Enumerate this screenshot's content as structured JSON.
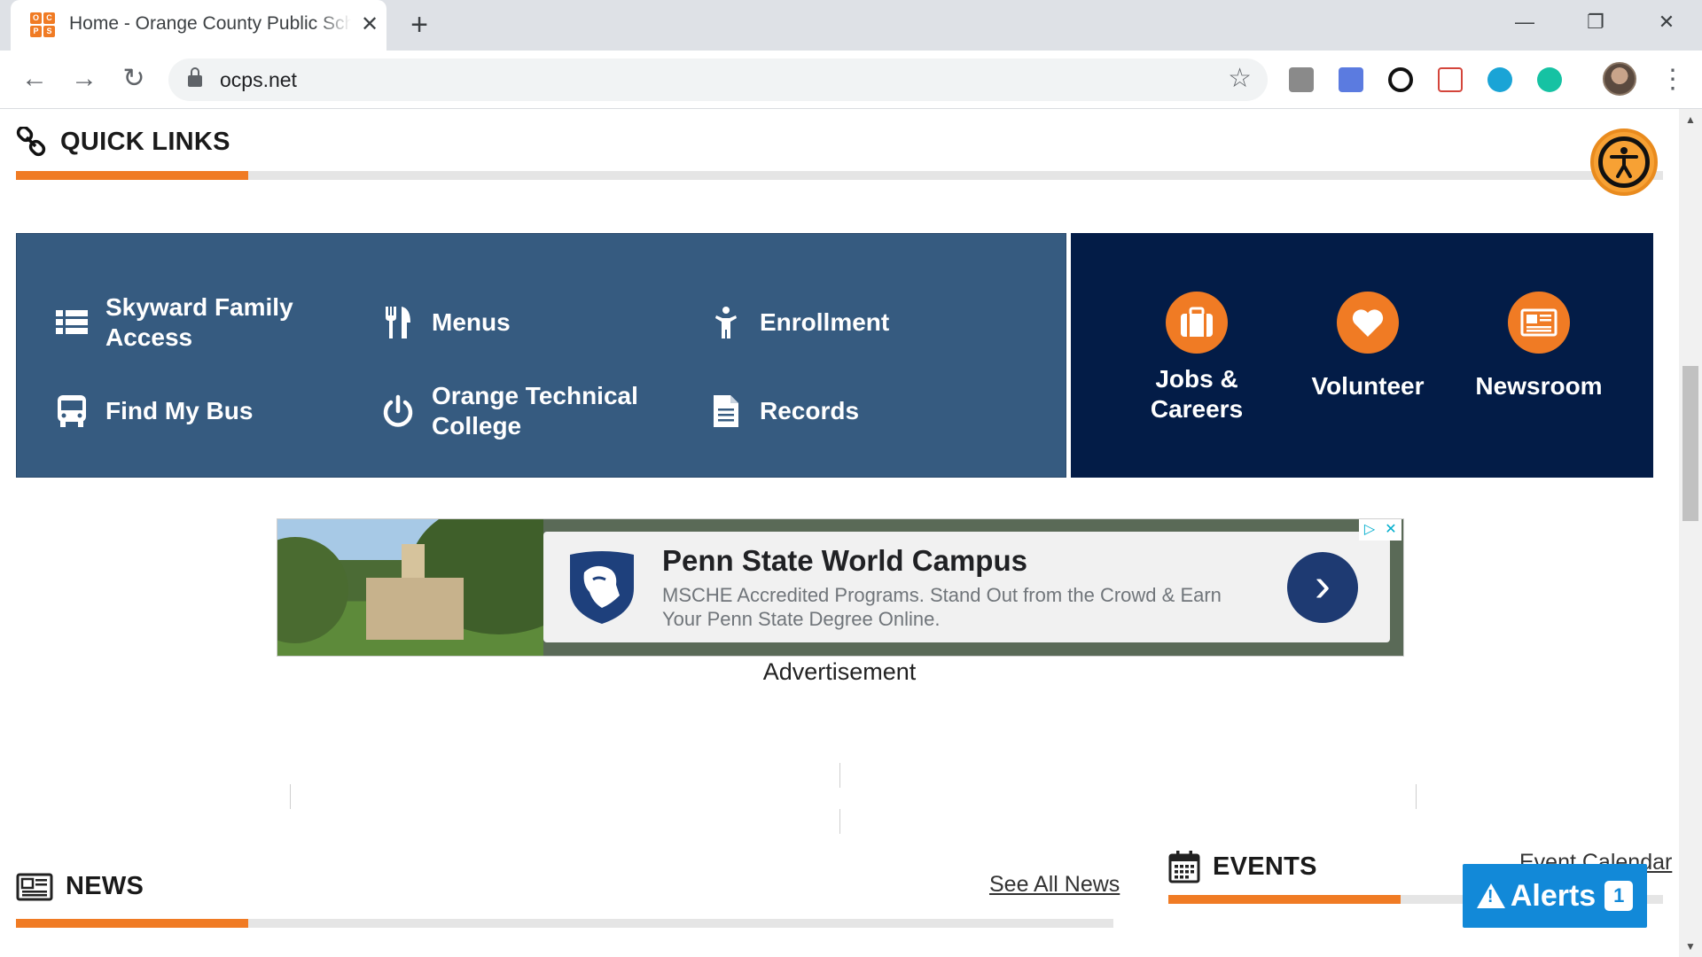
{
  "browser": {
    "tab_title": "Home - Orange County Public Schools",
    "url": "ocps.net",
    "favicon_letters": [
      "O",
      "C",
      "P",
      "S"
    ]
  },
  "quick_links": {
    "title": "QUICK LINKS",
    "left_items": [
      {
        "label_line1": "Skyward Family",
        "label_line2": "Access",
        "icon": "list-icon"
      },
      {
        "label_line1": "Menus",
        "label_line2": "",
        "icon": "fork-knife-icon"
      },
      {
        "label_line1": "Enrollment",
        "label_line2": "",
        "icon": "person-icon"
      },
      {
        "label_line1": "Find My Bus",
        "label_line2": "",
        "icon": "bus-icon"
      },
      {
        "label_line1": "Orange Technical",
        "label_line2": "College",
        "icon": "power-icon"
      },
      {
        "label_line1": "Records",
        "label_line2": "",
        "icon": "document-icon"
      }
    ],
    "right_items": [
      {
        "label_line1": "Jobs &",
        "label_line2": "Careers",
        "icon": "briefcase-icon"
      },
      {
        "label_line1": "Volunteer",
        "label_line2": "",
        "icon": "heart-icon"
      },
      {
        "label_line1": "Newsroom",
        "label_line2": "",
        "icon": "newspaper-icon"
      }
    ]
  },
  "ad": {
    "title": "Penn State World Campus",
    "description": "MSCHE Accredited Programs. Stand Out from the Crowd & Earn Your Penn State Degree Online.",
    "caption": "Advertisement"
  },
  "news": {
    "title": "NEWS",
    "see_all": "See All News"
  },
  "events": {
    "title": "EVENTS",
    "calendar_link": "Event Calendar"
  },
  "alerts": {
    "label": "Alerts",
    "count": "1"
  },
  "colors": {
    "accent": "#f07b24",
    "quick_links_blue": "#365b80",
    "navy": "#031c47",
    "alerts_blue": "#1289d8"
  }
}
